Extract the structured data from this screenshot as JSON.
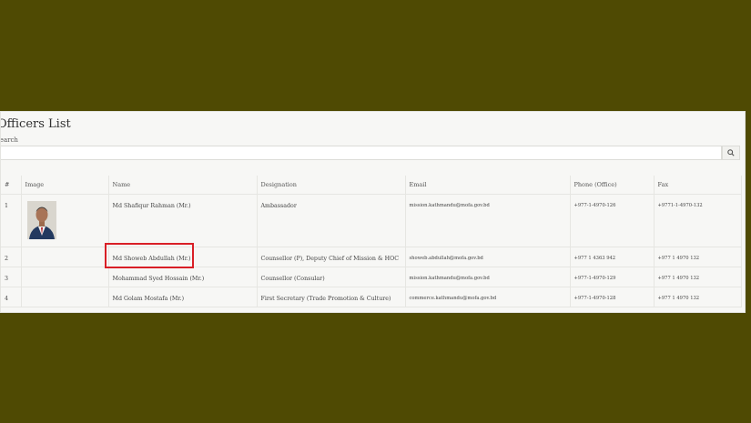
{
  "page": {
    "title": "Officers List",
    "search_label": "Search",
    "search_placeholder": ""
  },
  "table": {
    "headers": [
      "#",
      "Image",
      "Name",
      "Designation",
      "Email",
      "Phone (Office)",
      "Fax"
    ],
    "rows": [
      {
        "no": "1",
        "name": "Md Shafiqur Rahman (Mr.)",
        "designation": "Ambassador",
        "email": "mission.kathmandu@mofa.gov.bd",
        "phone": "+977-1-4970-126",
        "fax": "+9771-1-4970-132",
        "has_photo": true
      },
      {
        "no": "2",
        "name": "Md Showeb Abdullah (Mr.)",
        "designation": "Counsellor (P), Deputy Chief of Mission & HOC",
        "email": "showeb.abdullah@mofa.gov.bd",
        "phone": "+977 1 4363 942",
        "fax": "+977 1 4970 132",
        "has_photo": false
      },
      {
        "no": "3",
        "name": "Mohammad Syed Hossain (Mr.)",
        "designation": "Counsellor (Consular)",
        "email": "mission.kathmandu@mofa.gov.bd",
        "phone": "+977-1-4970-129",
        "fax": "+977 1 4970 132",
        "has_photo": false
      },
      {
        "no": "4",
        "name": "Md Golam Mostafa (Mr.)",
        "designation": "First Secretary (Trade Promotion & Culture)",
        "email": "commerce.kathmandu@mofa.gov.bd",
        "phone": "+977-1-4970-128",
        "fax": "+977 1 4970 132",
        "has_photo": false
      }
    ]
  },
  "icons": {
    "search": "search-icon"
  },
  "colors": {
    "background": "#4f4a03",
    "highlight": "#d91f26",
    "panel": "#f7f7f5"
  }
}
